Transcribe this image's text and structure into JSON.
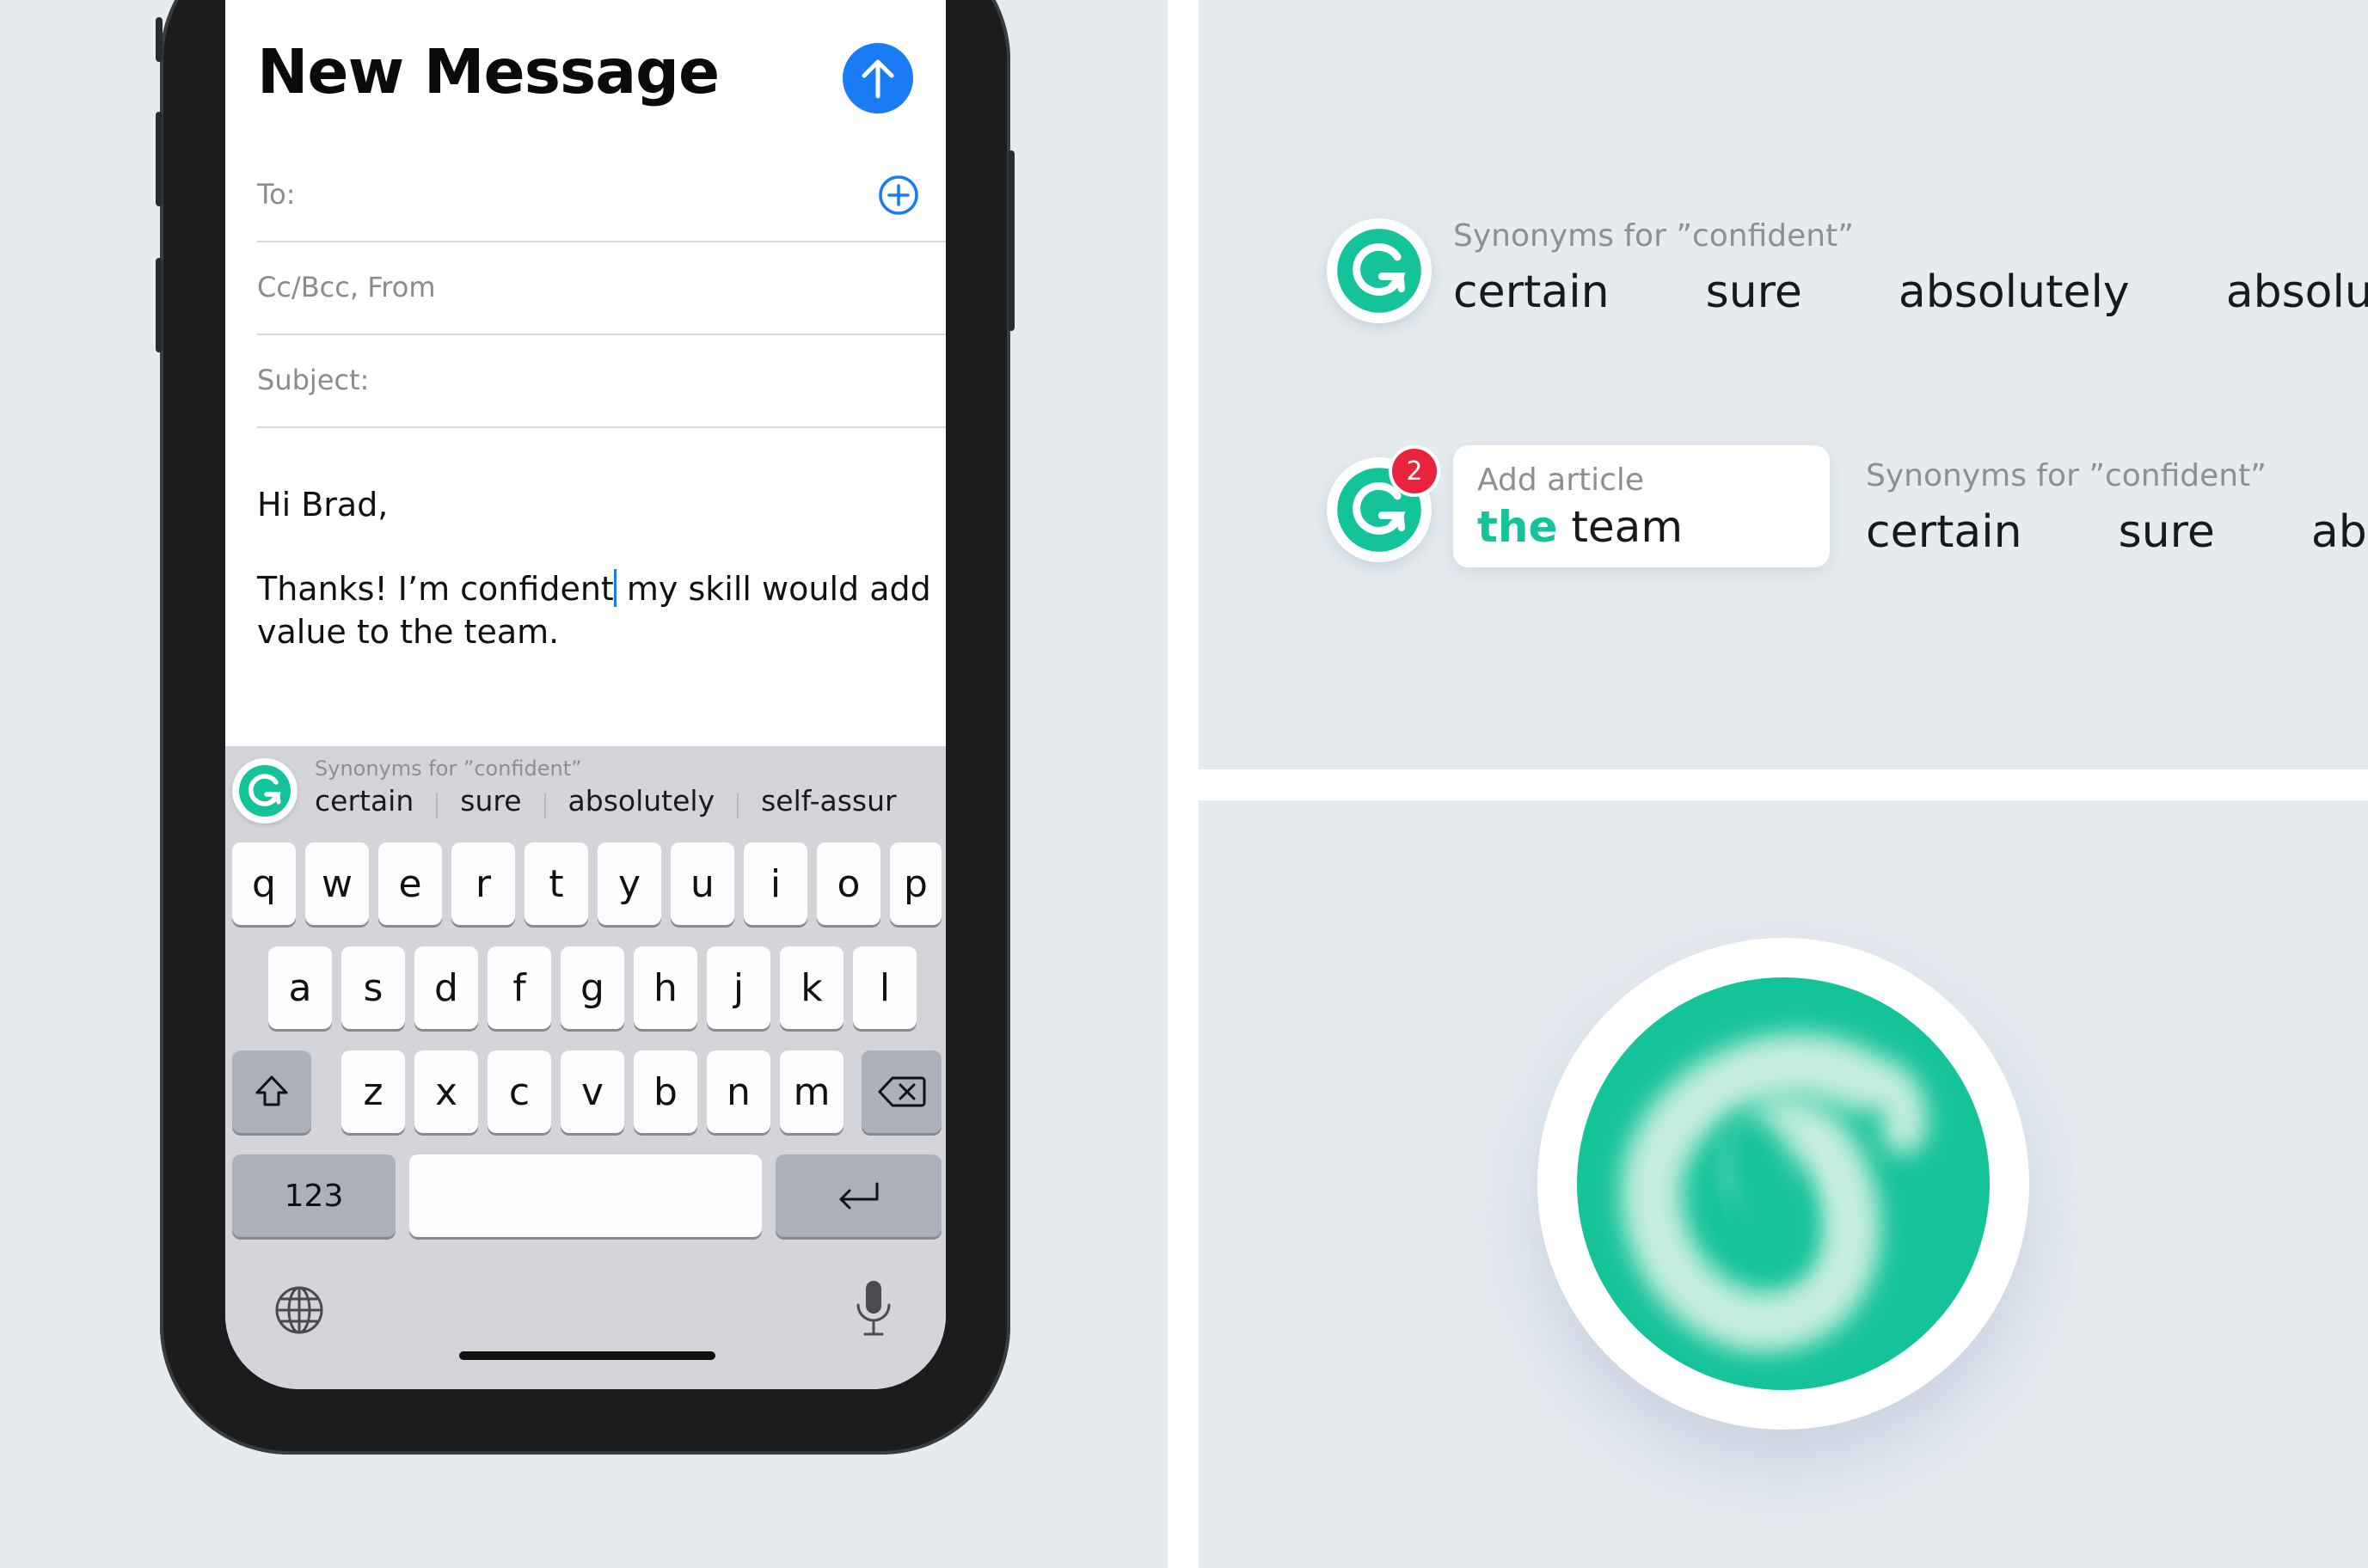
{
  "colors": {
    "brand_green": "#15c39a",
    "ios_blue": "#1a7cf5",
    "badge_red": "#e8243d",
    "background": "#e5ebef"
  },
  "compose": {
    "title": "New Message",
    "send_icon": "arrow-up-icon",
    "to_label": "To:",
    "add_icon": "plus-circle-icon",
    "ccbcc_label": "Cc/Bcc, From",
    "subject_label": "Subject:",
    "greeting": "Hi Brad,",
    "body_before_caret": "Thanks! I’m confident",
    "body_after_caret": " my skill would add",
    "body_line2": "value to the team."
  },
  "keyboard": {
    "suggestion_header": "Synonyms for ”confident”",
    "suggestions": [
      "certain",
      "sure",
      "absolutely",
      "self-assur"
    ],
    "row1": [
      "q",
      "w",
      "e",
      "r",
      "t",
      "y",
      "u",
      "i",
      "o",
      "p"
    ],
    "row2": [
      "a",
      "s",
      "d",
      "f",
      "g",
      "h",
      "j",
      "k",
      "l"
    ],
    "row3": [
      "z",
      "x",
      "c",
      "v",
      "b",
      "n",
      "m"
    ],
    "shift_icon": "shift-icon",
    "delete_icon": "backspace-icon",
    "numbers_label": "123",
    "return_icon": "return-icon",
    "globe_icon": "globe-icon",
    "mic_icon": "microphone-icon"
  },
  "panel_synonyms": {
    "header": "Synonyms for ”confident”",
    "words": [
      "certain",
      "sure",
      "absolutely",
      "absolut"
    ]
  },
  "panel_article": {
    "badge_count": "2",
    "card_header": "Add article",
    "card_highlight": "the",
    "card_rest": " team",
    "header": "Synonyms for ”confident”",
    "words": [
      "certain",
      "sure",
      "ab"
    ]
  },
  "logo": {
    "icon": "grammarly-logo-icon"
  }
}
